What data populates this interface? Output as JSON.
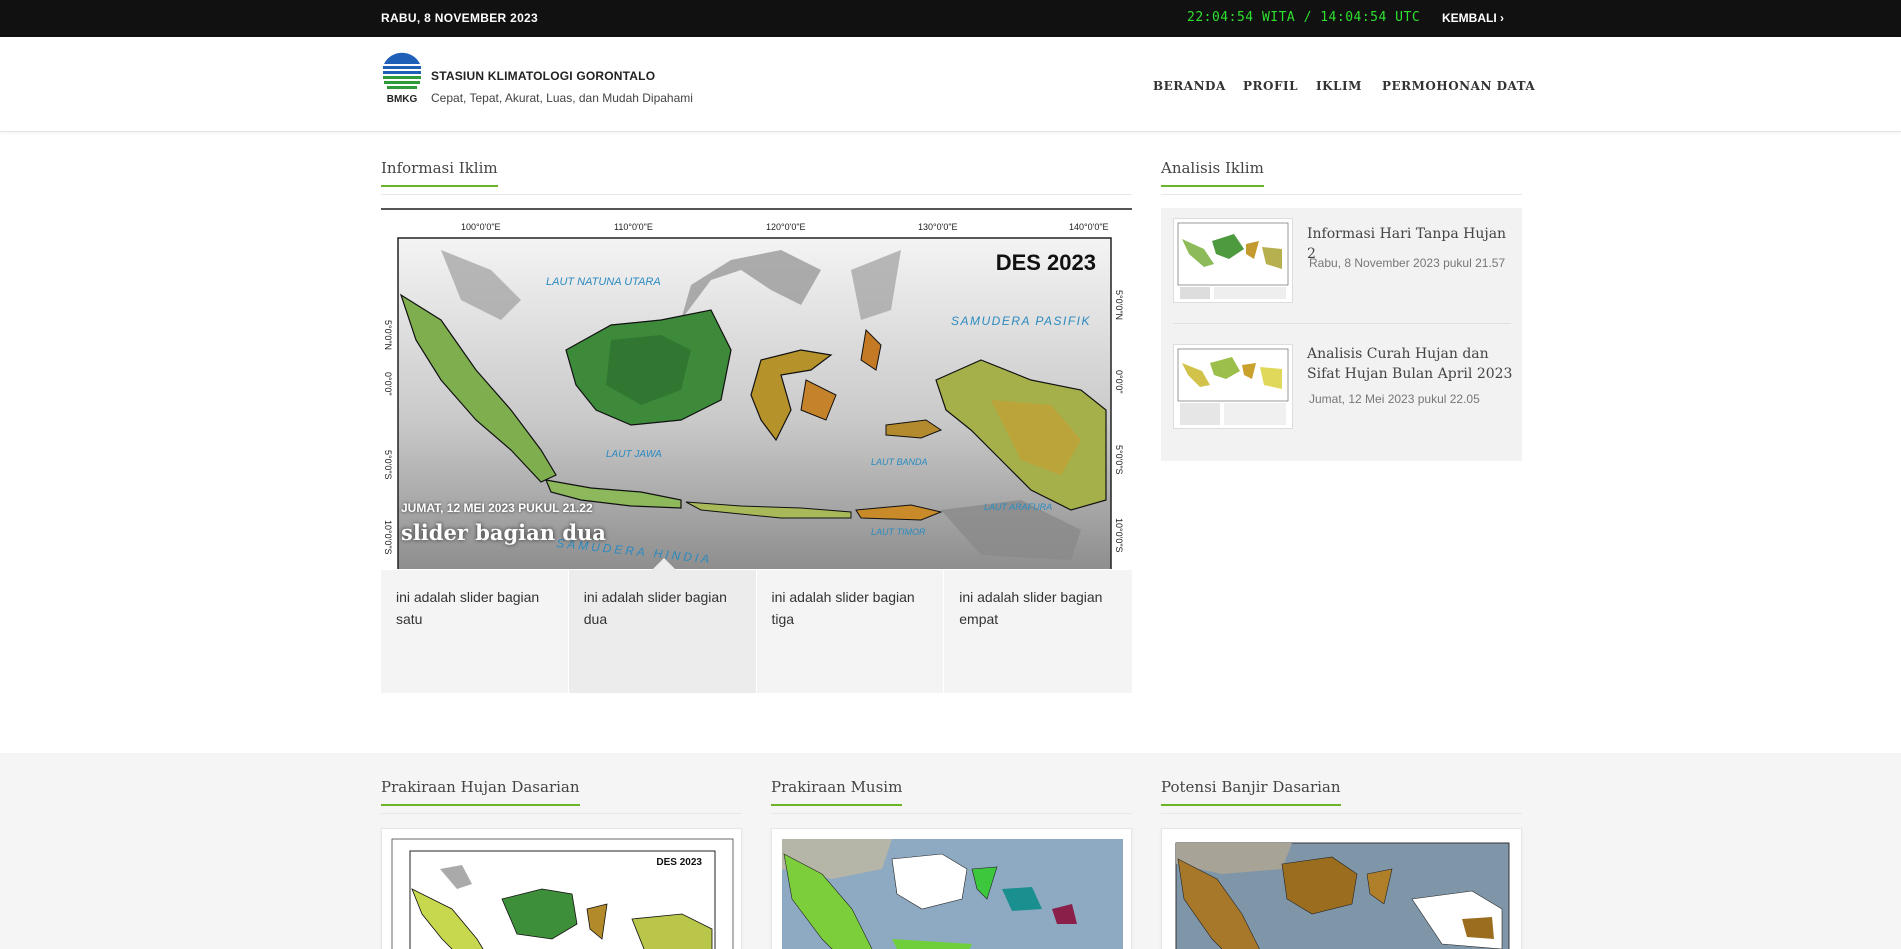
{
  "topbar": {
    "date": "RABU, 8 NOVEMBER 2023",
    "clock": "22:04:54 WITA / 14:04:54 UTC",
    "back_label": "KEMBALI ›"
  },
  "header": {
    "logo_text": "BMKG",
    "title": "STASIUN KLIMATOLOGI GORONTALO",
    "tagline": "Cepat, Tepat, Akurat, Luas, dan Mudah Dipahami",
    "nav": [
      "BERANDA",
      "PROFIL",
      "IKLIM",
      "PERMOHONAN DATA"
    ]
  },
  "main": {
    "heading": "Informasi Iklim",
    "slider": {
      "map_title": "DES 2023",
      "longitudes": [
        "100°0'0\"E",
        "110°0'0\"E",
        "120°0'0\"E",
        "130°0'0\"E",
        "140°0'0\"E"
      ],
      "latitudes": [
        "5°0'0\"N",
        "0°0'0\"",
        "5°0'0\"S",
        "10°0'0\"S"
      ],
      "sea_labels": [
        "LAUT NATUNA UTARA",
        "SAMUDERA PASIFIK",
        "LAUT JAWA",
        "LAUT BANDA",
        "LAUT ARAFURA",
        "LAUT TIMOR",
        "SAMUDERA HINDIA"
      ],
      "current_date": "JUMAT, 12 MEI 2023 PUKUL 21.22",
      "current_title": "slider bagian dua",
      "thumbs": [
        "ini adalah slider bagian satu",
        "ini adalah slider bagian dua",
        "ini adalah slider bagian tiga",
        "ini adalah slider bagian empat"
      ]
    }
  },
  "analysis": {
    "heading": "Analisis Iklim",
    "items": [
      {
        "title": "Informasi Hari Tanpa Hujan 2",
        "date": "Rabu, 8 November 2023 pukul 21.57"
      },
      {
        "title": "Analisis Curah Hujan dan Sifat Hujan Bulan April 2023",
        "date": "Jumat, 12 Mei 2023 pukul 22.05"
      }
    ]
  },
  "bottom": {
    "headings": [
      "Prakiraan Hujan Dasarian",
      "Prakiraan Musim",
      "Potensi Banjir Dasarian"
    ],
    "card_map_title": "DES 2023"
  },
  "colors": {
    "accent": "#6cb42a",
    "topbar_bg": "#111111",
    "clock": "#2ee02e"
  }
}
